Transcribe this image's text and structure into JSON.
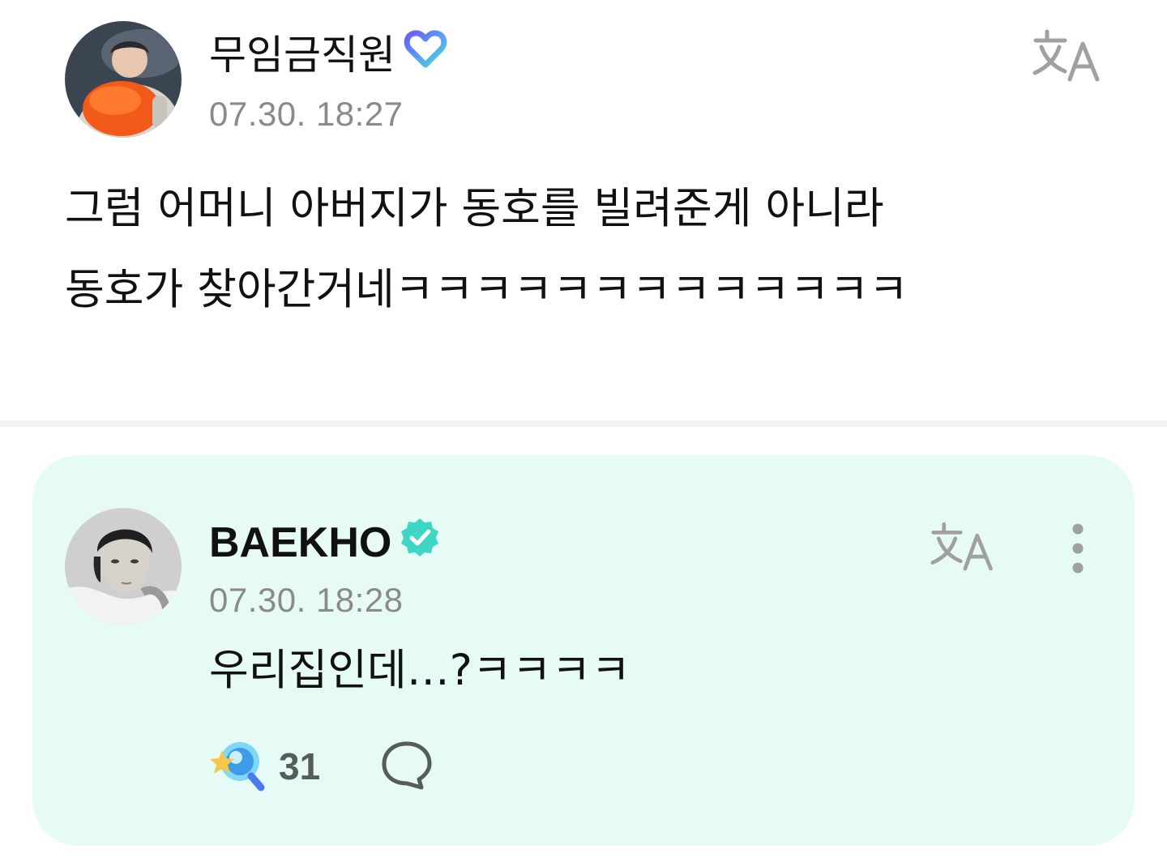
{
  "post": {
    "author": "무임금직원",
    "timestamp": "07.30. 18:27",
    "lines": [
      "그럼 어머니 아버지가 동호를 빌려준게 아니라",
      "동호가 찾아간거네ㅋㅋㅋㅋㅋㅋㅋㅋㅋㅋㅋㅋㅋ"
    ],
    "badge_icon": "membership-heart-icon",
    "translate_icon": "translate-icon"
  },
  "reply": {
    "author": "BAEKHO",
    "timestamp": "07.30. 18:28",
    "text": "우리집인데…?ㅋㅋㅋㅋ",
    "badge_icon": "verified-badge-icon",
    "translate_icon": "translate-icon",
    "menu_icon": "more-vertical-icon",
    "reaction_icon": "star-lightstick-icon",
    "reaction_count": "31",
    "comment_icon": "comment-bubble-icon"
  },
  "colors": {
    "reply_background": "#e7fbf6",
    "verified": "#3ed6c5",
    "timestamp": "#8a8a8a",
    "icon_gray": "#a0a0a0"
  }
}
